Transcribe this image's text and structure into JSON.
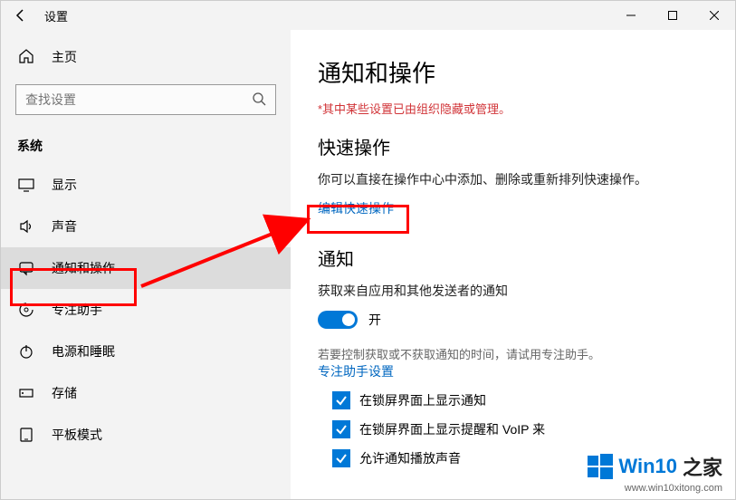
{
  "titlebar": {
    "title": "设置"
  },
  "sidebar": {
    "home": "主页",
    "search_placeholder": "查找设置",
    "category": "系统",
    "items": [
      {
        "label": "显示"
      },
      {
        "label": "声音"
      },
      {
        "label": "通知和操作"
      },
      {
        "label": "专注助手"
      },
      {
        "label": "电源和睡眠"
      },
      {
        "label": "存储"
      },
      {
        "label": "平板模式"
      }
    ]
  },
  "content": {
    "page_title": "通知和操作",
    "warning": "*其中某些设置已由组织隐藏或管理。",
    "quick_actions_heading": "快速操作",
    "quick_actions_desc": "你可以直接在操作中心中添加、删除或重新排列快速操作。",
    "edit_quick_actions": "编辑快速操作",
    "notifications_heading": "通知",
    "notifications_desc": "获取来自应用和其他发送者的通知",
    "toggle_label": "开",
    "focus_desc": "若要控制获取或不获取通知的时间，请试用专注助手。",
    "focus_link": "专注助手设置",
    "checkboxes": [
      "在锁屏界面上显示通知",
      "在锁屏界面上显示提醒和 VoIP 来",
      "允许通知播放声音"
    ]
  },
  "watermark": {
    "brand": "Win10",
    "suffix": "之家",
    "url": "www.win10xitong.com"
  }
}
